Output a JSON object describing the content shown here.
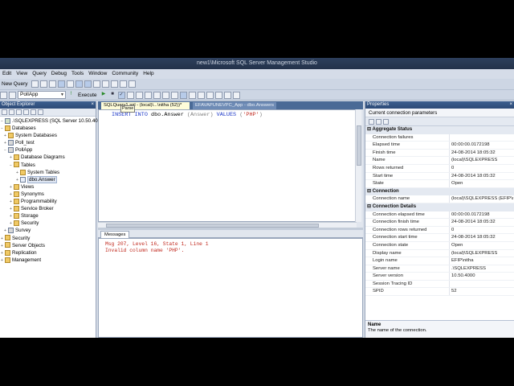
{
  "window": {
    "title": "new1\\Microsoft SQL Server Management Studio"
  },
  "menu": [
    "Edit",
    "View",
    "Query",
    "Debug",
    "Tools",
    "Window",
    "Community",
    "Help"
  ],
  "toolbar1": {
    "new_query": "New Query"
  },
  "toolbar2": {
    "database": "PollApp",
    "execute": "Execute",
    "tooltip": "Parse"
  },
  "object_explorer": {
    "title": "Object Explorer",
    "server": ".\\SQLEXPRESS (SQL Server 10.50.4000 - EFIP\\nitha)",
    "nodes": [
      "Databases",
      "System Databases",
      "Poll_test",
      "PollApp",
      "Database Diagrams",
      "Tables",
      "System Tables",
      "dbo.Answer",
      "Views",
      "Synonyms",
      "Programmability",
      "Service Broker",
      "Storage",
      "Security",
      "Survey",
      "Security",
      "Server Objects",
      "Replication",
      "Management"
    ]
  },
  "document": {
    "tab_active": "SQLQuery1.sql - (local)\\...\\nitha (52))*",
    "tab_inactive": "EFAVAPUNEVPC_App - dbo.Answers",
    "code": {
      "kw1": "INSERT",
      "kw2": "INTO",
      "table": "dbo.Answer",
      "cols": "(Answer)",
      "kw3": "VALUES",
      "open": "(",
      "value": "'PHP'",
      "close": ")"
    },
    "results_tab": "Messages",
    "messages": [
      "Msg 207, Level 16, State 1, Line 1",
      "Invalid column name 'PHP'."
    ]
  },
  "properties": {
    "title": "Properties",
    "context": "Current connection parameters",
    "categories": [
      {
        "name": "Aggregate Status",
        "rows": [
          {
            "k": "Connection failures",
            "v": ""
          },
          {
            "k": "Elapsed time",
            "v": "00:00:00.0172198"
          },
          {
            "k": "Finish time",
            "v": "24-08-2014 18:05:32"
          },
          {
            "k": "Name",
            "v": "(local)\\SQLEXPRESS"
          },
          {
            "k": "Rows returned",
            "v": "0"
          },
          {
            "k": "Start time",
            "v": "24-08-2014 18:05:32"
          },
          {
            "k": "State",
            "v": "Open"
          }
        ]
      },
      {
        "name": "Connection",
        "rows": [
          {
            "k": "Connection name",
            "v": "(local)\\SQLEXPRESS (EFIP\\nitha)"
          }
        ]
      },
      {
        "name": "Connection Details",
        "rows": [
          {
            "k": "Connection elapsed time",
            "v": "00:00:00.0172198"
          },
          {
            "k": "Connection finish time",
            "v": "24-08-2014 18:05:32"
          },
          {
            "k": "Connection rows returned",
            "v": "0"
          },
          {
            "k": "Connection start time",
            "v": "24-08-2014 18:05:32"
          },
          {
            "k": "Connection state",
            "v": "Open"
          },
          {
            "k": "Display name",
            "v": "(local)\\SQLEXPRESS"
          },
          {
            "k": "Login name",
            "v": "EFIP\\nitha"
          },
          {
            "k": "Server name",
            "v": ".\\SQLEXPRESS"
          },
          {
            "k": "Server version",
            "v": "10.50.4000"
          },
          {
            "k": "Session Tracing ID",
            "v": ""
          },
          {
            "k": "SPID",
            "v": "52"
          }
        ]
      }
    ],
    "desc_title": "Name",
    "desc_text": "The name of the connection."
  }
}
